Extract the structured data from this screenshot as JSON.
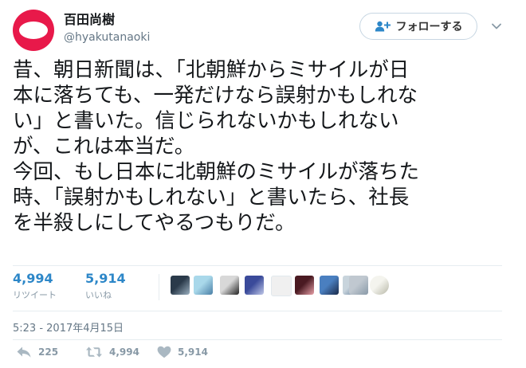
{
  "author": {
    "display_name": "百田尚樹",
    "handle": "@hyakutanaoki",
    "avatar_color": "#e8194a",
    "avatar_icon": "white-oval"
  },
  "follow_button": {
    "label": "フォローする",
    "icon": "person-plus-icon"
  },
  "tweet": {
    "lines": [
      "昔、朝日新聞は、「北朝鮮からミサイルが日",
      "本に落ちても、一発だけなら誤射かもしれな",
      "い」と書いた。信じられないかもしれない",
      "が、これは本当だ。",
      "今回、もし日本に北朝鮮のミサイルが落ちた",
      "時、「誤射かもしれない」と書いたら、社長",
      "を半殺しにしてやるつもりだ。"
    ]
  },
  "stats": {
    "retweets": {
      "count": "4,994",
      "label": "リツイート"
    },
    "likes": {
      "count": "5,914",
      "label": "いいね"
    }
  },
  "likers": [
    {
      "name": "liker-avatar-1",
      "colors": [
        "#2a3a4a",
        "#9bb0c0"
      ]
    },
    {
      "name": "liker-avatar-2",
      "colors": [
        "#a9d8ea",
        "#4a7fa6"
      ]
    },
    {
      "name": "liker-avatar-3",
      "colors": [
        "#d8d8d8",
        "#222222"
      ]
    },
    {
      "name": "liker-avatar-4",
      "colors": [
        "#3a4a9a",
        "#c0c8e8"
      ]
    },
    {
      "name": "liker-avatar-5",
      "colors": [
        "#f0f0f0",
        "#f0f0f0"
      ]
    },
    {
      "name": "liker-avatar-6",
      "colors": [
        "#4a1a22",
        "#e8a0a8"
      ]
    },
    {
      "name": "liker-avatar-7",
      "colors": [
        "#4a7fc0",
        "#1a2a4a"
      ]
    },
    {
      "name": "liker-avatar-8",
      "colors": [
        "#c8d4dc",
        "#4a6a8a"
      ]
    },
    {
      "name": "liker-avatar-9",
      "colors": [
        "#c0c8d0",
        "#8a9aa8"
      ]
    },
    {
      "name": "liker-avatar-10",
      "colors": [
        "#f4f4ee",
        "#b8b8a8"
      ]
    }
  ],
  "timestamp": "5:23 - 2017年4月15日",
  "actions": {
    "reply": {
      "count": "225",
      "icon": "reply-icon"
    },
    "retweet": {
      "count": "4,994",
      "icon": "retweet-icon"
    },
    "like": {
      "count": "5,914",
      "icon": "heart-icon"
    }
  },
  "colors": {
    "link_blue": "#2d87c8",
    "muted": "#8899a6",
    "text": "#14171a",
    "divider": "#e6ecf0"
  }
}
